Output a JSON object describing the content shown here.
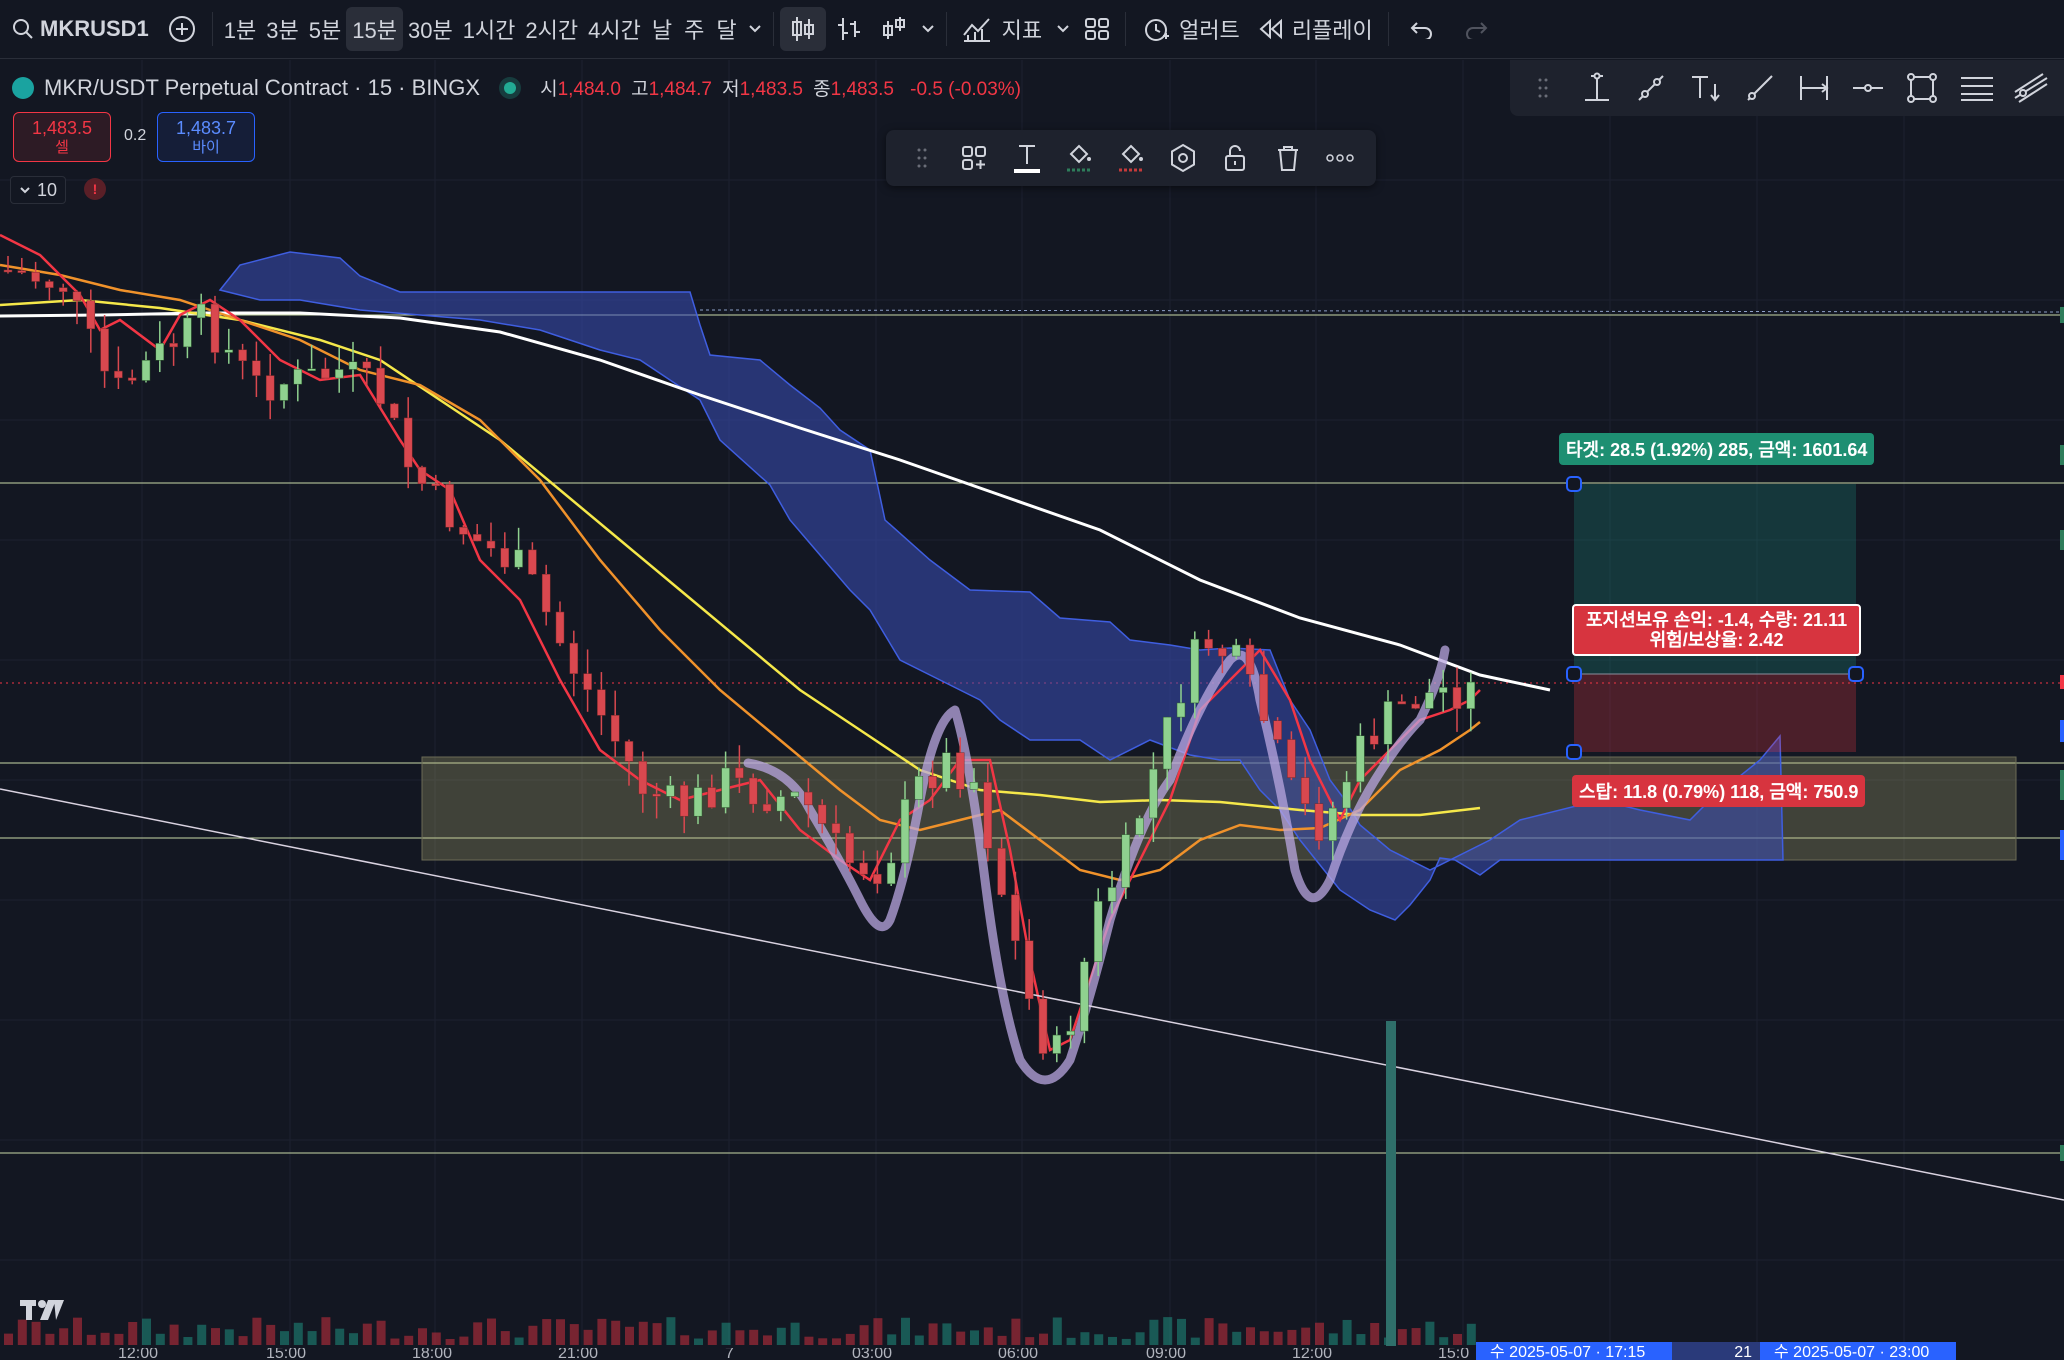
{
  "toolbar": {
    "symbol": "MKRUSD1",
    "intervals": [
      "1분",
      "3분",
      "5분",
      "15분",
      "30분",
      "1시간",
      "2시간",
      "4시간",
      "날",
      "주",
      "달"
    ],
    "active_interval": "15분",
    "indicators_label": "지표",
    "alert_label": "얼러트",
    "replay_label": "리플레이"
  },
  "legend": {
    "title": "MKR/USDT Perpetual Contract · 15 · BINGX",
    "open_label": "시",
    "open": "1,484.0",
    "high_label": "고",
    "high": "1,484.7",
    "low_label": "저",
    "low": "1,483.5",
    "close_label": "종",
    "close": "1,483.5",
    "change": "-0.5 (-0.03%)"
  },
  "trade": {
    "sell_price": "1,483.5",
    "sell_label": "셀",
    "spread": "0.2",
    "buy_price": "1,483.7",
    "buy_label": "바이"
  },
  "indicators": {
    "count": "10",
    "warning": "!"
  },
  "position": {
    "target": "타겟: 28.5 (1.92%) 285, 금액: 1601.64",
    "pnl_line1": "포지션보유 손익: -1.4, 수량: 21.11",
    "pnl_line2": "위험/보상율: 2.42",
    "stop": "스탑: 11.8 (0.79%) 118, 금액: 750.9"
  },
  "time_axis": {
    "ticks": [
      "12:00",
      "15:00",
      "18:00",
      "21:00",
      "7",
      "03:00",
      "06:00",
      "09:00",
      "12:00",
      "15:0"
    ],
    "tag_1": "수 2025-05-07 · 17:15",
    "tag_mid": "21",
    "tag_2": "수 2025-05-07 · 23:00"
  },
  "colors": {
    "bg": "#131722",
    "up": "#8fd18f",
    "down": "#d9484f",
    "ema_fast": "#f23645",
    "ema_mid": "#f0922b",
    "ema_slow": "#f5e84a",
    "ema_long": "#ffffff",
    "cloud": "#3a4fb8",
    "freehand": "#b9a7e0"
  }
}
